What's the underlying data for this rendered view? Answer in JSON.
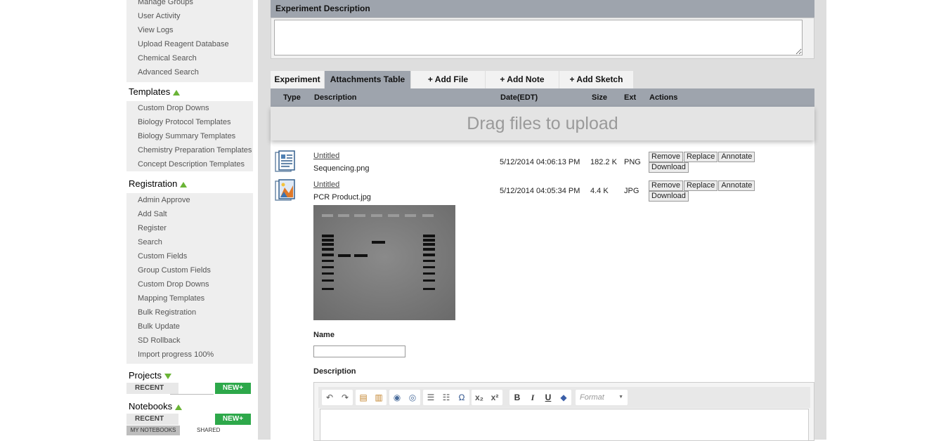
{
  "admin_items": [
    "Manage Groups",
    "User Activity",
    "View Logs",
    "Upload Reagent Database",
    "Chemical Search",
    "Advanced Search"
  ],
  "templates": {
    "title": "Templates",
    "items": [
      "Custom Drop Downs",
      "Biology Protocol Templates",
      "Biology Summary Templates",
      "Chemistry Preparation Templates",
      "Concept Description Templates"
    ]
  },
  "registration": {
    "title": "Registration",
    "items": [
      "Admin Approve",
      "Add Salt",
      "Register",
      "Search",
      "Custom Fields",
      "Group Custom Fields",
      "Custom Drop Downs",
      "Mapping Templates",
      "Bulk Registration",
      "Bulk Update",
      "SD Rollback",
      "Import progress 100%"
    ]
  },
  "projects": {
    "title": "Projects",
    "recent": "RECENT",
    "new": "NEW+"
  },
  "notebooks": {
    "title": "Notebooks",
    "recent": "RECENT",
    "new": "NEW+",
    "my": "MY NOTEBOOKS",
    "shared": "SHARED"
  },
  "experiment_description": {
    "title": "Experiment Description"
  },
  "tabs": {
    "experiment": "Experiment",
    "attachments": "Attachments Table",
    "add_file": "+ Add File",
    "add_note": "+ Add Note",
    "add_sketch": "+ Add Sketch"
  },
  "columns": {
    "type": "Type",
    "description": "Description",
    "date": "Date(EDT)",
    "size": "Size",
    "ext": "Ext",
    "actions": "Actions"
  },
  "dropzone": "Drag files to upload",
  "actions": {
    "remove": "Remove",
    "replace": "Replace",
    "annotate": "Annotate",
    "download": "Download"
  },
  "attachments": [
    {
      "title": "Untitled",
      "file": "Sequencing.png",
      "date": "5/12/2014 04:06:13 PM",
      "size": "182.2 K",
      "ext": "PNG",
      "icon": "document-icon"
    },
    {
      "title": "Untitled",
      "file": "PCR Product.jpg",
      "date": "5/12/2014 04:05:34 PM",
      "size": "4.4 K",
      "ext": "JPG",
      "icon": "image-icon"
    }
  ],
  "form": {
    "name_label": "Name",
    "description_label": "Description",
    "format_placeholder": "Format"
  },
  "colors": {
    "header_gray": "#9ea4ad",
    "new_green": "#2da84a",
    "arrow_green": "#6ab436"
  }
}
